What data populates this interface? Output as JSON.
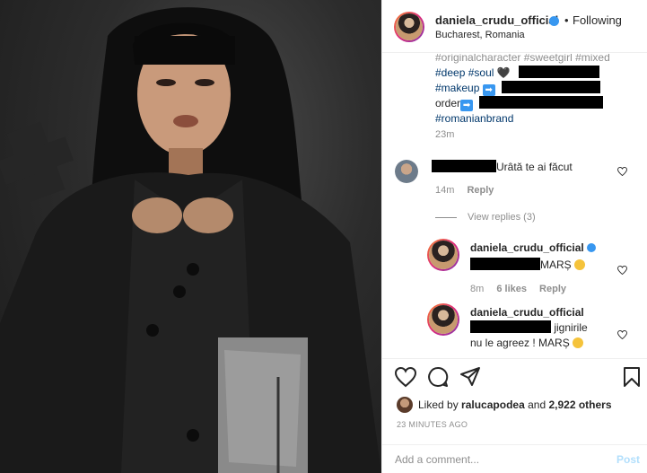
{
  "header": {
    "username": "daniela_crudu_official",
    "dot": "•",
    "follow_state": "Following",
    "location": "Bucharest, Romania"
  },
  "caption": {
    "line_faded": "#originalcharacter #sweetgirl #mixed",
    "tag_deep": "#deep",
    "tag_soul": "#soul",
    "heart": "🖤",
    "tag_makeup": "#makeup",
    "arrow": "➡",
    "order": "order",
    "tag_brand": "#romanianbrand",
    "time": "23m"
  },
  "comments": [
    {
      "text": "Urâtă te ai făcut",
      "time": "14m",
      "reply": "Reply",
      "view_replies": "View replies (3)"
    }
  ],
  "replies": [
    {
      "username": "daniela_crudu_official",
      "text": "MARȘ",
      "time": "8m",
      "likes": "6 likes",
      "reply": "Reply"
    },
    {
      "username": "daniela_crudu_official",
      "text_1": "jignirile",
      "text_2": "nu le agreez ! MARȘ"
    }
  ],
  "actions": {
    "liked_prefix": "Liked by",
    "liked_user": "ralucapodea",
    "liked_and": "and",
    "liked_others": "2,922 others",
    "posted_ago": "23 MINUTES AGO"
  },
  "add_comment": {
    "placeholder": "Add a comment...",
    "post_label": "Post"
  },
  "colors": {
    "link": "#00376b",
    "verified": "#3897f0",
    "muted": "#8e8e8e",
    "post_disabled": "#b2dffc"
  }
}
